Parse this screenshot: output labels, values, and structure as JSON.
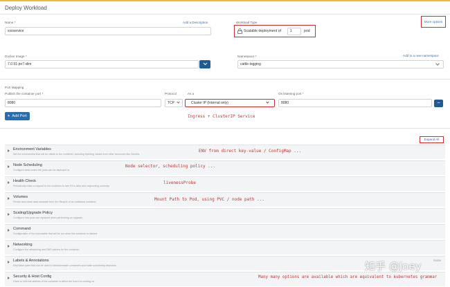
{
  "page": {
    "title": "Deploy Workload"
  },
  "form": {
    "name_label": "Name *",
    "add_description": "Add a Description",
    "name_value": "xxxservice",
    "workload_type_label": "Workload Type",
    "scalable_text": "Scalable deployment of",
    "scalable_count": "1",
    "scalable_unit": "pod",
    "more_options": "More options",
    "docker_image_label": "Docker Image *",
    "docker_image_value": "7.0.91-jre7-slim",
    "namespace_label": "Namespace *",
    "add_namespace": "Add to a new namespace",
    "namespace_value": "cattle-logging"
  },
  "ports": {
    "section_label": "Port Mapping",
    "publish_label": "Publish the container port *",
    "protocol_label": "Protocol",
    "as_a_label": "As a",
    "listening_label": "On listening port *",
    "publish_value": "8080",
    "protocol_value": "TCP",
    "as_a_value": "Cluster IP (Internal only)",
    "listening_value": "8080",
    "add_port": "Add Port",
    "remove_glyph": "−",
    "add_glyph": "+"
  },
  "expand_all": "Expand All",
  "sections": [
    {
      "title": "Environment Variables",
      "desc": "Set the environment that will be visible to the container, including injecting values from other resources like Secrets."
    },
    {
      "title": "Node Scheduling",
      "desc": "Configure what nodes the pods can be deployed to."
    },
    {
      "title": "Health Check",
      "desc": "Periodically make a request to the container to see if it is alive and responding correctly."
    },
    {
      "title": "Volumes",
      "desc": "Persist and share data separate from the lifecycle of an individual container."
    },
    {
      "title": "Scaling/Upgrade Policy",
      "desc": "Configure how pods are replaced when performing an upgrade."
    },
    {
      "title": "Command",
      "desc": "Configuration of the executable that will be run when the container is started."
    },
    {
      "title": "Networking",
      "desc": "Configure the networking and DNS options for the container."
    },
    {
      "title": "Labels & Annotations",
      "desc": "Key/Value pairs that can be used to label/annotate containers and make scheduling decisions.",
      "badge": "None"
    },
    {
      "title": "Security & Host Config",
      "desc": "Grant or limit the abilities of the container to affect the host it is running on."
    }
  ],
  "annotations": {
    "ingress": "Ingress + ClusterIP Service",
    "env": "ENV from direct key-value / ConfigMap ...",
    "node": "Node selector, scheduling policy ...",
    "health": "livenessProbe",
    "volumes": "Mount Path to Pod, using PVC / node path ...",
    "bottom": "Many many options are available which are equivalent to kubernetes grammar"
  },
  "watermark": "知乎 @Joey",
  "colors": {
    "accent": "#2a6cb0",
    "annotation": "#c9302c",
    "topbar": "#e8b84a"
  },
  "icons": {
    "lock": "lock-icon",
    "chevron": "chevron-down-icon",
    "caret": "caret-right-icon"
  }
}
